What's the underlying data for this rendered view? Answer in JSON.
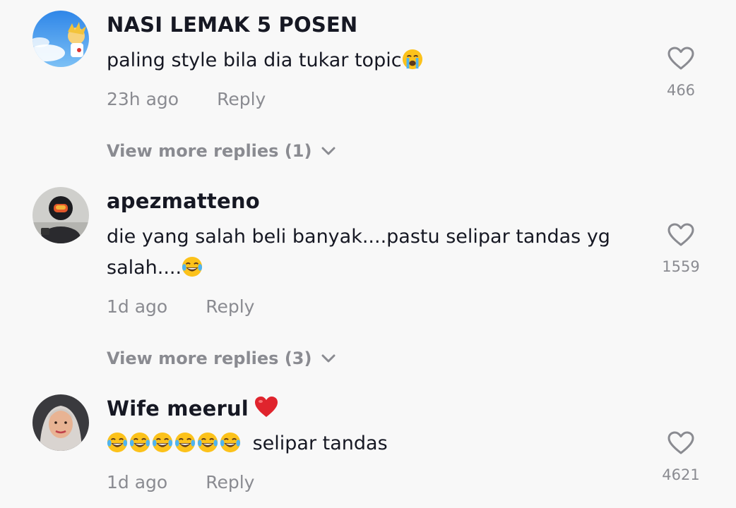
{
  "comments": [
    {
      "username": "NASI LEMAK 5 POSEN",
      "text": "paling style bila dia tukar topic",
      "text_emoji": "loudly-crying-face",
      "time": "23h ago",
      "reply_label": "Reply",
      "likes": "466",
      "view_more": "View more replies (1)"
    },
    {
      "username": "apezmatteno",
      "text_line1": "die yang salah beli banyak....pastu selipar tandas yg",
      "text_line2": "salah....",
      "text_emoji": "face-with-tears-of-joy",
      "time": "1d ago",
      "reply_label": "Reply",
      "likes": "1559",
      "view_more": "View more replies (3)"
    },
    {
      "username": "Wife meerul",
      "username_emoji": "red-heart",
      "text_prefix_emoji": "face-with-tears-of-joy x6",
      "text": "selipar tandas",
      "time": "1d ago",
      "reply_label": "Reply",
      "likes": "4621"
    }
  ],
  "colors": {
    "background": "#f8f8f8",
    "primary_text": "#161823",
    "secondary_text": "#8a8b91",
    "heart_outline": "#8a8b91",
    "emoji_heart": "#e0242d"
  }
}
